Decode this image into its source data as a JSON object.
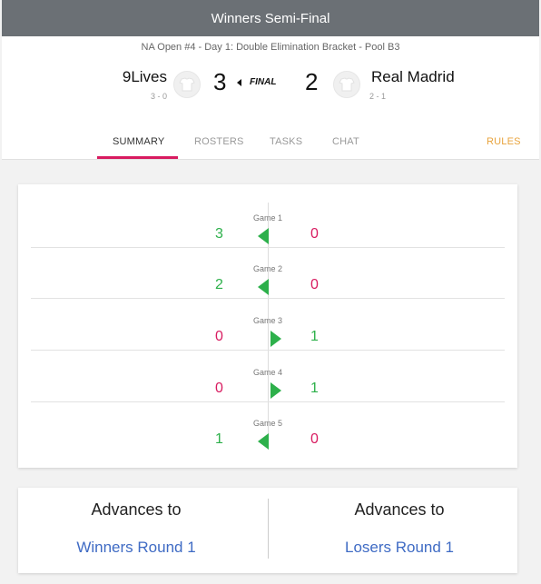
{
  "title": "Winners Semi-Final",
  "header": {
    "subtitle": "NA Open #4 - Day 1: Double Elimination Bracket - Pool B3",
    "team_left": {
      "name": "9Lives",
      "record": "3 - 0",
      "score": "3"
    },
    "team_right": {
      "name": "Real Madrid",
      "record": "2 - 1",
      "score": "2"
    },
    "status": "FINAL"
  },
  "tabs": {
    "summary": "SUMMARY",
    "rosters": "ROSTERS",
    "tasks": "TASKS",
    "chat": "CHAT",
    "rules": "RULES"
  },
  "games": [
    {
      "label": "Game 1",
      "left": "3",
      "right": "0",
      "winner": "left"
    },
    {
      "label": "Game 2",
      "left": "2",
      "right": "0",
      "winner": "left"
    },
    {
      "label": "Game 3",
      "left": "0",
      "right": "1",
      "winner": "right"
    },
    {
      "label": "Game 4",
      "left": "0",
      "right": "1",
      "winner": "right"
    },
    {
      "label": "Game 5",
      "left": "1",
      "right": "0",
      "winner": "left"
    }
  ],
  "advance": {
    "left": {
      "heading": "Advances to",
      "link": "Winners Round 1"
    },
    "right": {
      "heading": "Advances to",
      "link": "Losers Round 1"
    }
  },
  "colors": {
    "win": "#2db04b",
    "lose": "#d81b60",
    "link": "#3f6bc4",
    "rules": "#e8a33c",
    "titlebar": "#6b7075"
  }
}
